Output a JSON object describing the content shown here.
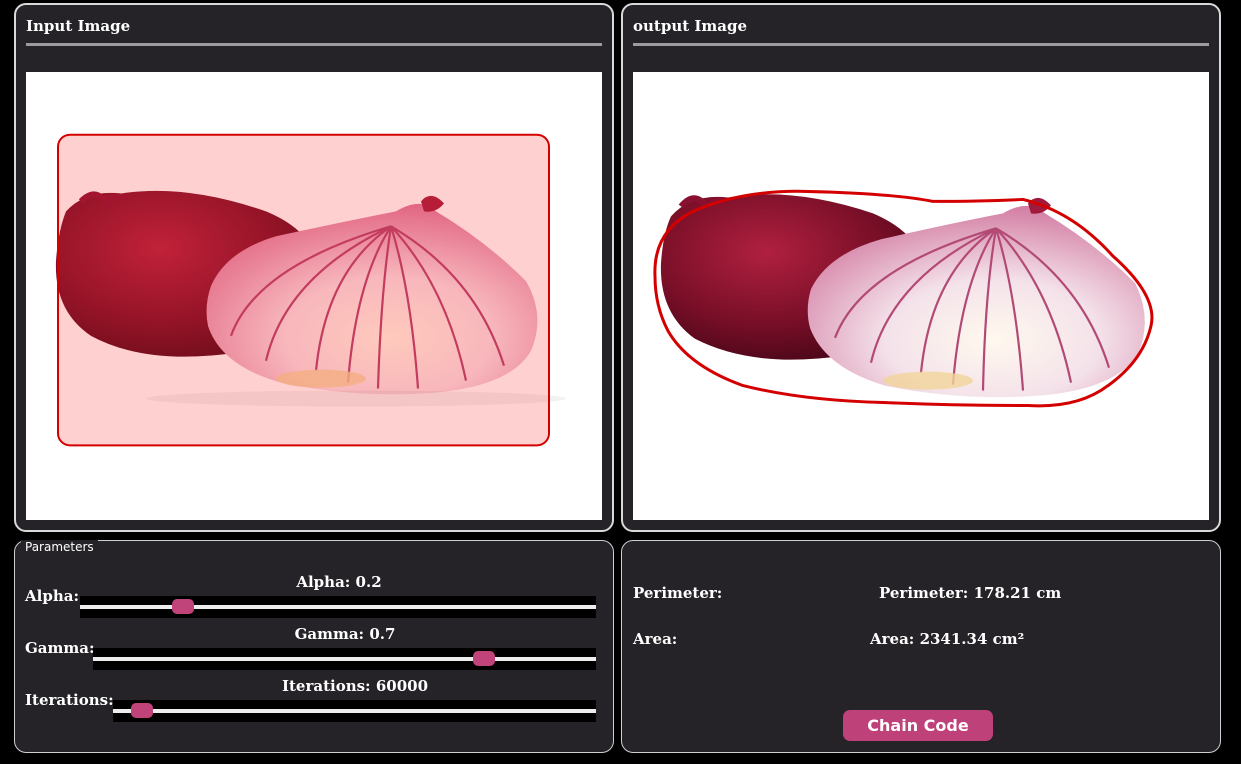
{
  "input_panel": {
    "title": "Input Image"
  },
  "output_panel": {
    "title": "output Image"
  },
  "parameters": {
    "legend": "Parameters",
    "alpha": {
      "label": "Alpha:",
      "caption": "Alpha: 0.2",
      "value": 0.2,
      "max": 1.0
    },
    "gamma": {
      "label": "Gamma:",
      "caption": "Gamma: 0.7",
      "value": 0.7,
      "max": 0.9
    },
    "iterations": {
      "label": "Iterations:",
      "caption": "Iterations: 60000",
      "value": 60000,
      "max": 1000000
    }
  },
  "results": {
    "perimeter_label": "Perimeter:",
    "perimeter_value": "Perimeter: 178.21 cm",
    "area_label": "Area:",
    "area_value": "Area: 2341.34 cm²",
    "chain_code_button": "Chain Code"
  },
  "colors": {
    "accent": "#bf4179",
    "contour": "#d40000",
    "panel_bg": "#252327"
  }
}
